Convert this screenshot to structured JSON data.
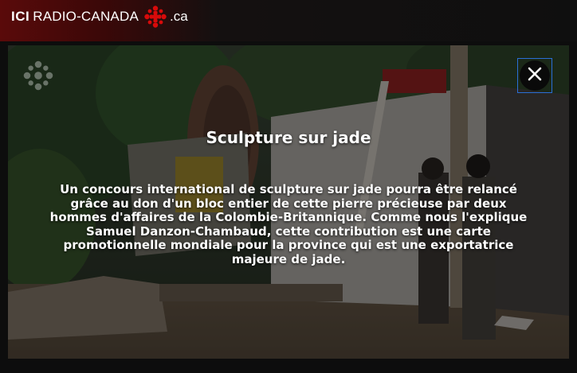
{
  "header": {
    "logo_ici": "ICI",
    "logo_name": "RADIO-CANADA",
    "logo_tld": ".ca"
  },
  "icons": {
    "brand_logo": "radio-canada-gem-icon",
    "close": "close-icon",
    "watermark": "radio-canada-gem-icon"
  },
  "colors": {
    "brand_red": "#d80a0a",
    "header_gradient_start": "#5a0a0a",
    "focus_outline": "#2a6fd6"
  },
  "video": {
    "title": "Sculpture sur jade",
    "description": "Un concours international de sculpture sur jade pourra être relancé grâce au don d'un bloc entier de cette pierre précieuse par deux hommes d'affaires de la Colombie-Britannique. Comme nous l'explique Samuel Danzon-Chambaud, cette contribution est une carte promotionnelle mondiale pour la province qui est une exportatrice majeure de jade."
  }
}
